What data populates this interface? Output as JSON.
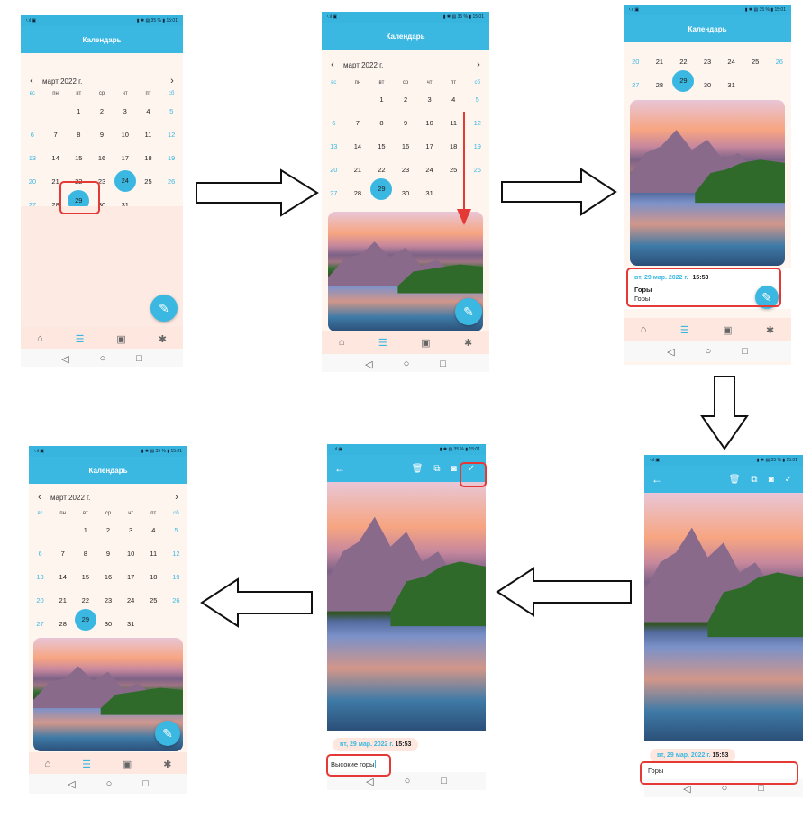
{
  "app": {
    "title": "Календарь",
    "month": "март 2022 г.",
    "prev": "‹",
    "next": "›",
    "weekdays": [
      "вс",
      "пн",
      "вт",
      "ср",
      "чт",
      "пт",
      "сб"
    ],
    "status_left": "ᵗ.ıl ▣",
    "status_right": "▮ ✱ ▤ 35 % ▮ 15:01"
  },
  "calendar_rows": [
    [
      "",
      "",
      "1",
      "2",
      "3",
      "4",
      "5"
    ],
    [
      "6",
      "7",
      "8",
      "9",
      "10",
      "11",
      "12"
    ],
    [
      "13",
      "14",
      "15",
      "16",
      "17",
      "18",
      "19"
    ],
    [
      "20",
      "21",
      "22",
      "23",
      "24",
      "25",
      "26"
    ],
    [
      "27",
      "28",
      "29",
      "30",
      "31",
      "",
      ""
    ]
  ],
  "partial_rows": [
    [
      "20",
      "21",
      "22",
      "23",
      "24",
      "25",
      "26"
    ],
    [
      "27",
      "28",
      "29",
      "30",
      "31",
      "",
      ""
    ]
  ],
  "badge_count": "1",
  "entry": {
    "date": "вт, 29 мар. 2022 г.",
    "time": "15:53",
    "title": "Горы",
    "body": "Горы"
  },
  "edit": {
    "text_original": "Горы",
    "text_edited_prefix": "Высокие ",
    "text_edited_word": "горы"
  },
  "icons": {
    "home": "⌂",
    "list": "☰",
    "gallery": "▣",
    "settings": "✱",
    "back": "◁",
    "circle": "○",
    "square": "□",
    "pencil": "✎",
    "arrow_left": "←",
    "trash": "🗑",
    "copy": "⧉",
    "camera": "◙",
    "check": "✓"
  },
  "colors": {
    "accent": "#3bb8e2",
    "highlight": "#e53935",
    "bg": "#fff5ef"
  }
}
